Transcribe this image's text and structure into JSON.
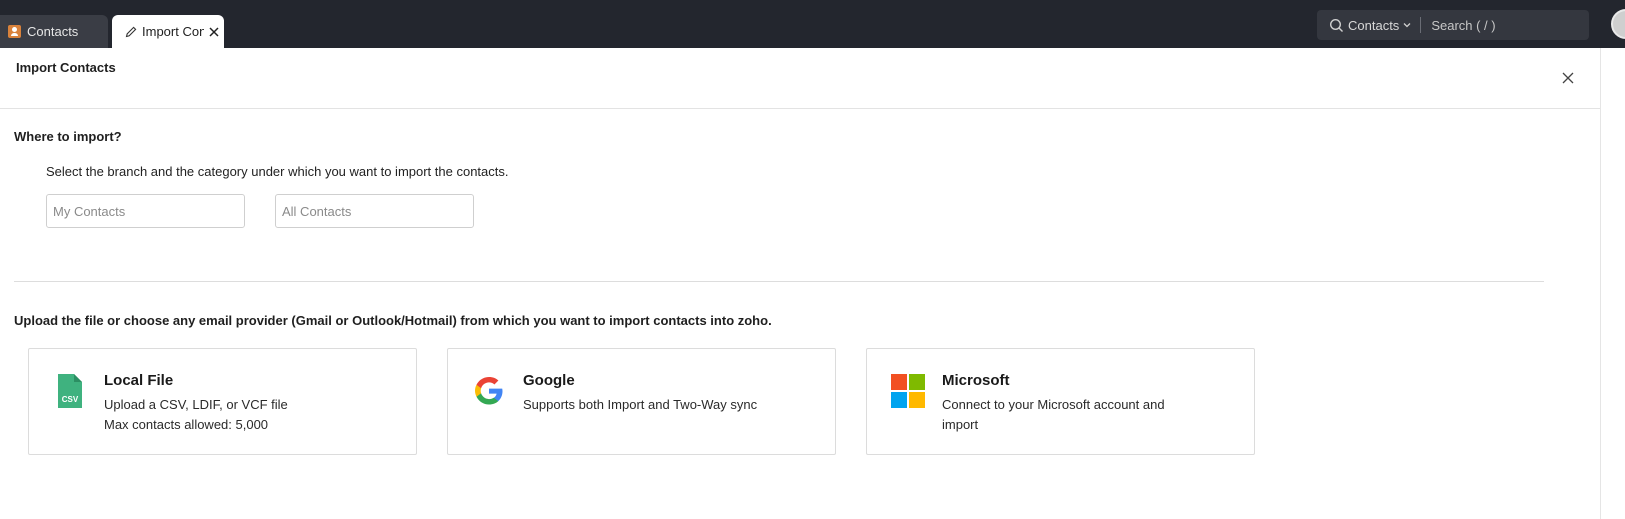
{
  "tabs": [
    {
      "label": "Contacts"
    },
    {
      "label": "Import Contacts"
    }
  ],
  "search": {
    "scope": "Contacts",
    "placeholder": "Search ( / )"
  },
  "page": {
    "title": "Import Contacts"
  },
  "where": {
    "heading": "Where to import?",
    "description": "Select the branch and the category under which you want to import the contacts.",
    "branch_placeholder": "My Contacts",
    "category_placeholder": "All Contacts"
  },
  "upload": {
    "heading": "Upload the file or choose any email provider (Gmail or Outlook/Hotmail) from which you want to import contacts into zoho.",
    "cards": [
      {
        "title": "Local File",
        "line1": "Upload a CSV, LDIF, or VCF file",
        "line2": "Max contacts allowed: 5,000",
        "icon": "csv-file-icon"
      },
      {
        "title": "Google",
        "line1": "Supports both Import and Two-Way sync",
        "line2": "",
        "icon": "google-icon"
      },
      {
        "title": "Microsoft",
        "line1": "Connect to your Microsoft account and",
        "line2": "import",
        "icon": "microsoft-icon"
      }
    ]
  },
  "icon_labels": {
    "csv": "CSV"
  },
  "colors": {
    "topbar": "#23262e",
    "csv_green": "#3fb27f",
    "google_blue": "#4285F4",
    "google_red": "#EA4335",
    "google_yellow": "#FBBC05",
    "google_green": "#34A853",
    "ms_red": "#F25022",
    "ms_green": "#7FBA00",
    "ms_blue": "#00A4EF",
    "ms_yellow": "#FFB900"
  }
}
